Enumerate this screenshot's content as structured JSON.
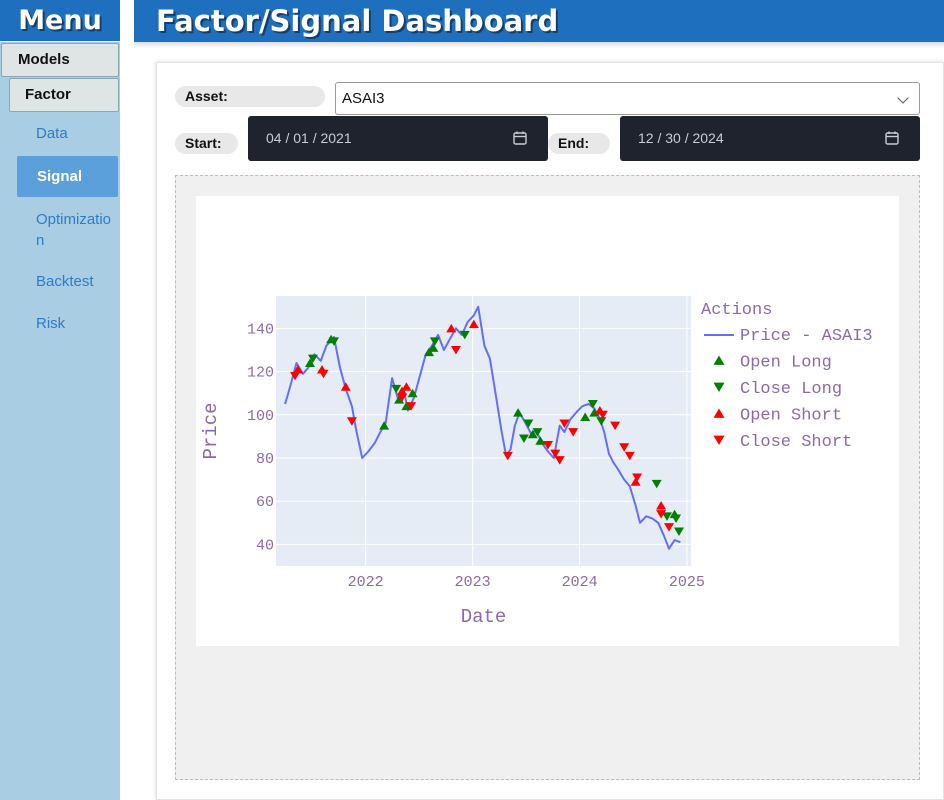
{
  "sidebar": {
    "title": "Menu",
    "models_label": "Models",
    "factor_label": "Factor",
    "items": [
      {
        "label": "Data",
        "active": false
      },
      {
        "label": "Signal",
        "active": true
      },
      {
        "label": "Optimization",
        "active": false
      },
      {
        "label": "Backtest",
        "active": false
      },
      {
        "label": "Risk",
        "active": false
      }
    ]
  },
  "header": {
    "title": "Factor/Signal Dashboard"
  },
  "filters": {
    "asset_label": "Asset:",
    "asset_value": "ASAI3",
    "start_label": "Start:",
    "start_value": "04 / 01 / 2021",
    "end_label": "End:",
    "end_value": "12 / 30 / 2024"
  },
  "colors": {
    "accent": "#1f6fbf",
    "sidebar_bg": "#a9cde3",
    "price_line": "#636efa",
    "long_marker": "#008000",
    "short_marker": "#ff0000",
    "plot_bg": "#e5ecf6",
    "text": "#8a6aa8"
  },
  "icons": {
    "calendar": "calendar-icon",
    "dropdown": "chevron-down-icon"
  },
  "chart_data": {
    "type": "line",
    "xlabel": "Date",
    "ylabel": "Price",
    "x_ticks": [
      "2022",
      "2023",
      "2024",
      "2025"
    ],
    "y_ticks": [
      40,
      60,
      80,
      100,
      120,
      140
    ],
    "xlim": [
      "2021-03-01",
      "2025-01-15"
    ],
    "ylim": [
      30,
      155
    ],
    "grid": true,
    "legend": {
      "title": "Actions",
      "placement": "right"
    },
    "series": [
      {
        "name": "Price - ASAI3",
        "kind": "line",
        "points": [
          [
            "2021-04-01",
            105
          ],
          [
            "2021-04-20",
            114
          ],
          [
            "2021-05-10",
            124
          ],
          [
            "2021-06-01",
            119
          ],
          [
            "2021-06-20",
            122
          ],
          [
            "2021-07-10",
            128
          ],
          [
            "2021-08-01",
            125
          ],
          [
            "2021-08-20",
            132
          ],
          [
            "2021-09-15",
            136
          ],
          [
            "2021-10-05",
            122
          ],
          [
            "2021-10-25",
            112
          ],
          [
            "2021-11-15",
            104
          ],
          [
            "2021-12-01",
            92
          ],
          [
            "2021-12-20",
            80
          ],
          [
            "2022-01-10",
            83
          ],
          [
            "2022-02-01",
            87
          ],
          [
            "2022-02-20",
            92
          ],
          [
            "2022-03-10",
            96
          ],
          [
            "2022-04-01",
            117
          ],
          [
            "2022-04-20",
            108
          ],
          [
            "2022-05-10",
            112
          ],
          [
            "2022-05-25",
            102
          ],
          [
            "2022-06-15",
            108
          ],
          [
            "2022-07-05",
            118
          ],
          [
            "2022-07-25",
            128
          ],
          [
            "2022-08-15",
            132
          ],
          [
            "2022-09-05",
            137
          ],
          [
            "2022-09-25",
            130
          ],
          [
            "2022-10-15",
            135
          ],
          [
            "2022-11-05",
            140
          ],
          [
            "2022-11-25",
            137
          ],
          [
            "2022-12-15",
            143
          ],
          [
            "2023-01-05",
            146
          ],
          [
            "2023-01-20",
            150
          ],
          [
            "2023-02-10",
            132
          ],
          [
            "2023-03-01",
            126
          ],
          [
            "2023-03-20",
            110
          ],
          [
            "2023-04-10",
            92
          ],
          [
            "2023-04-25",
            81
          ],
          [
            "2023-05-10",
            84
          ],
          [
            "2023-05-25",
            95
          ],
          [
            "2023-06-10",
            101
          ],
          [
            "2023-07-01",
            96
          ],
          [
            "2023-07-20",
            91
          ],
          [
            "2023-08-05",
            93
          ],
          [
            "2023-08-25",
            87
          ],
          [
            "2023-09-15",
            83
          ],
          [
            "2023-10-05",
            80
          ],
          [
            "2023-10-25",
            95
          ],
          [
            "2023-11-10",
            92
          ],
          [
            "2023-12-01",
            98
          ],
          [
            "2023-12-20",
            101
          ],
          [
            "2024-01-10",
            104
          ],
          [
            "2024-02-01",
            105
          ],
          [
            "2024-02-20",
            103
          ],
          [
            "2024-03-10",
            98
          ],
          [
            "2024-03-25",
            92
          ],
          [
            "2024-04-10",
            82
          ],
          [
            "2024-04-25",
            78
          ],
          [
            "2024-05-10",
            75
          ],
          [
            "2024-06-01",
            70
          ],
          [
            "2024-06-20",
            67
          ],
          [
            "2024-07-10",
            58
          ],
          [
            "2024-07-25",
            50
          ],
          [
            "2024-08-15",
            53
          ],
          [
            "2024-09-05",
            52
          ],
          [
            "2024-09-25",
            50
          ],
          [
            "2024-10-15",
            44
          ],
          [
            "2024-11-01",
            38
          ],
          [
            "2024-11-20",
            42
          ],
          [
            "2024-12-10",
            41
          ]
        ]
      },
      {
        "name": "Open Long",
        "kind": "marker-up",
        "points": [
          [
            "2021-06-25",
            124
          ],
          [
            "2021-09-05",
            135
          ],
          [
            "2022-03-05",
            95
          ],
          [
            "2022-04-25",
            107
          ],
          [
            "2022-05-20",
            104
          ],
          [
            "2022-06-10",
            110
          ],
          [
            "2022-08-05",
            129
          ],
          [
            "2022-08-20",
            131
          ],
          [
            "2023-06-05",
            101
          ],
          [
            "2023-07-25",
            91
          ],
          [
            "2023-08-20",
            88
          ],
          [
            "2024-01-20",
            99
          ],
          [
            "2024-02-20",
            101
          ],
          [
            "2024-11-20",
            54
          ]
        ]
      },
      {
        "name": "Close Long",
        "kind": "marker-down",
        "points": [
          [
            "2021-07-05",
            126
          ],
          [
            "2021-09-15",
            134
          ],
          [
            "2022-04-15",
            112
          ],
          [
            "2022-08-25",
            134
          ],
          [
            "2022-12-05",
            137
          ],
          [
            "2023-06-25",
            89
          ],
          [
            "2023-07-10",
            96
          ],
          [
            "2023-08-10",
            92
          ],
          [
            "2024-02-15",
            105
          ],
          [
            "2024-03-15",
            97
          ],
          [
            "2024-09-20",
            68
          ],
          [
            "2024-10-25",
            53
          ],
          [
            "2024-11-25",
            52
          ],
          [
            "2024-12-05",
            46
          ]
        ]
      },
      {
        "name": "Open Short",
        "kind": "marker-up",
        "points": [
          [
            "2021-05-15",
            121
          ],
          [
            "2021-08-05",
            121
          ],
          [
            "2021-10-25",
            113
          ],
          [
            "2022-05-05",
            111
          ],
          [
            "2022-05-20",
            113
          ],
          [
            "2022-10-20",
            140
          ],
          [
            "2023-01-05",
            142
          ],
          [
            "2024-03-10",
            102
          ],
          [
            "2024-07-10",
            69
          ],
          [
            "2024-10-05",
            58
          ]
        ]
      },
      {
        "name": "Close Short",
        "kind": "marker-down",
        "points": [
          [
            "2021-05-05",
            118
          ],
          [
            "2021-08-10",
            119
          ],
          [
            "2021-11-15",
            97
          ],
          [
            "2022-05-05",
            108
          ],
          [
            "2022-06-05",
            104
          ],
          [
            "2022-11-05",
            130
          ],
          [
            "2023-05-01",
            81
          ],
          [
            "2023-09-15",
            86
          ],
          [
            "2023-10-10",
            82
          ],
          [
            "2023-10-25",
            79
          ],
          [
            "2023-11-10",
            96
          ],
          [
            "2023-12-10",
            92
          ],
          [
            "2024-03-20",
            100
          ],
          [
            "2024-05-01",
            95
          ],
          [
            "2024-06-01",
            85
          ],
          [
            "2024-06-20",
            81
          ],
          [
            "2024-07-15",
            71
          ],
          [
            "2024-10-05",
            54
          ],
          [
            "2024-11-01",
            48
          ]
        ]
      }
    ]
  }
}
